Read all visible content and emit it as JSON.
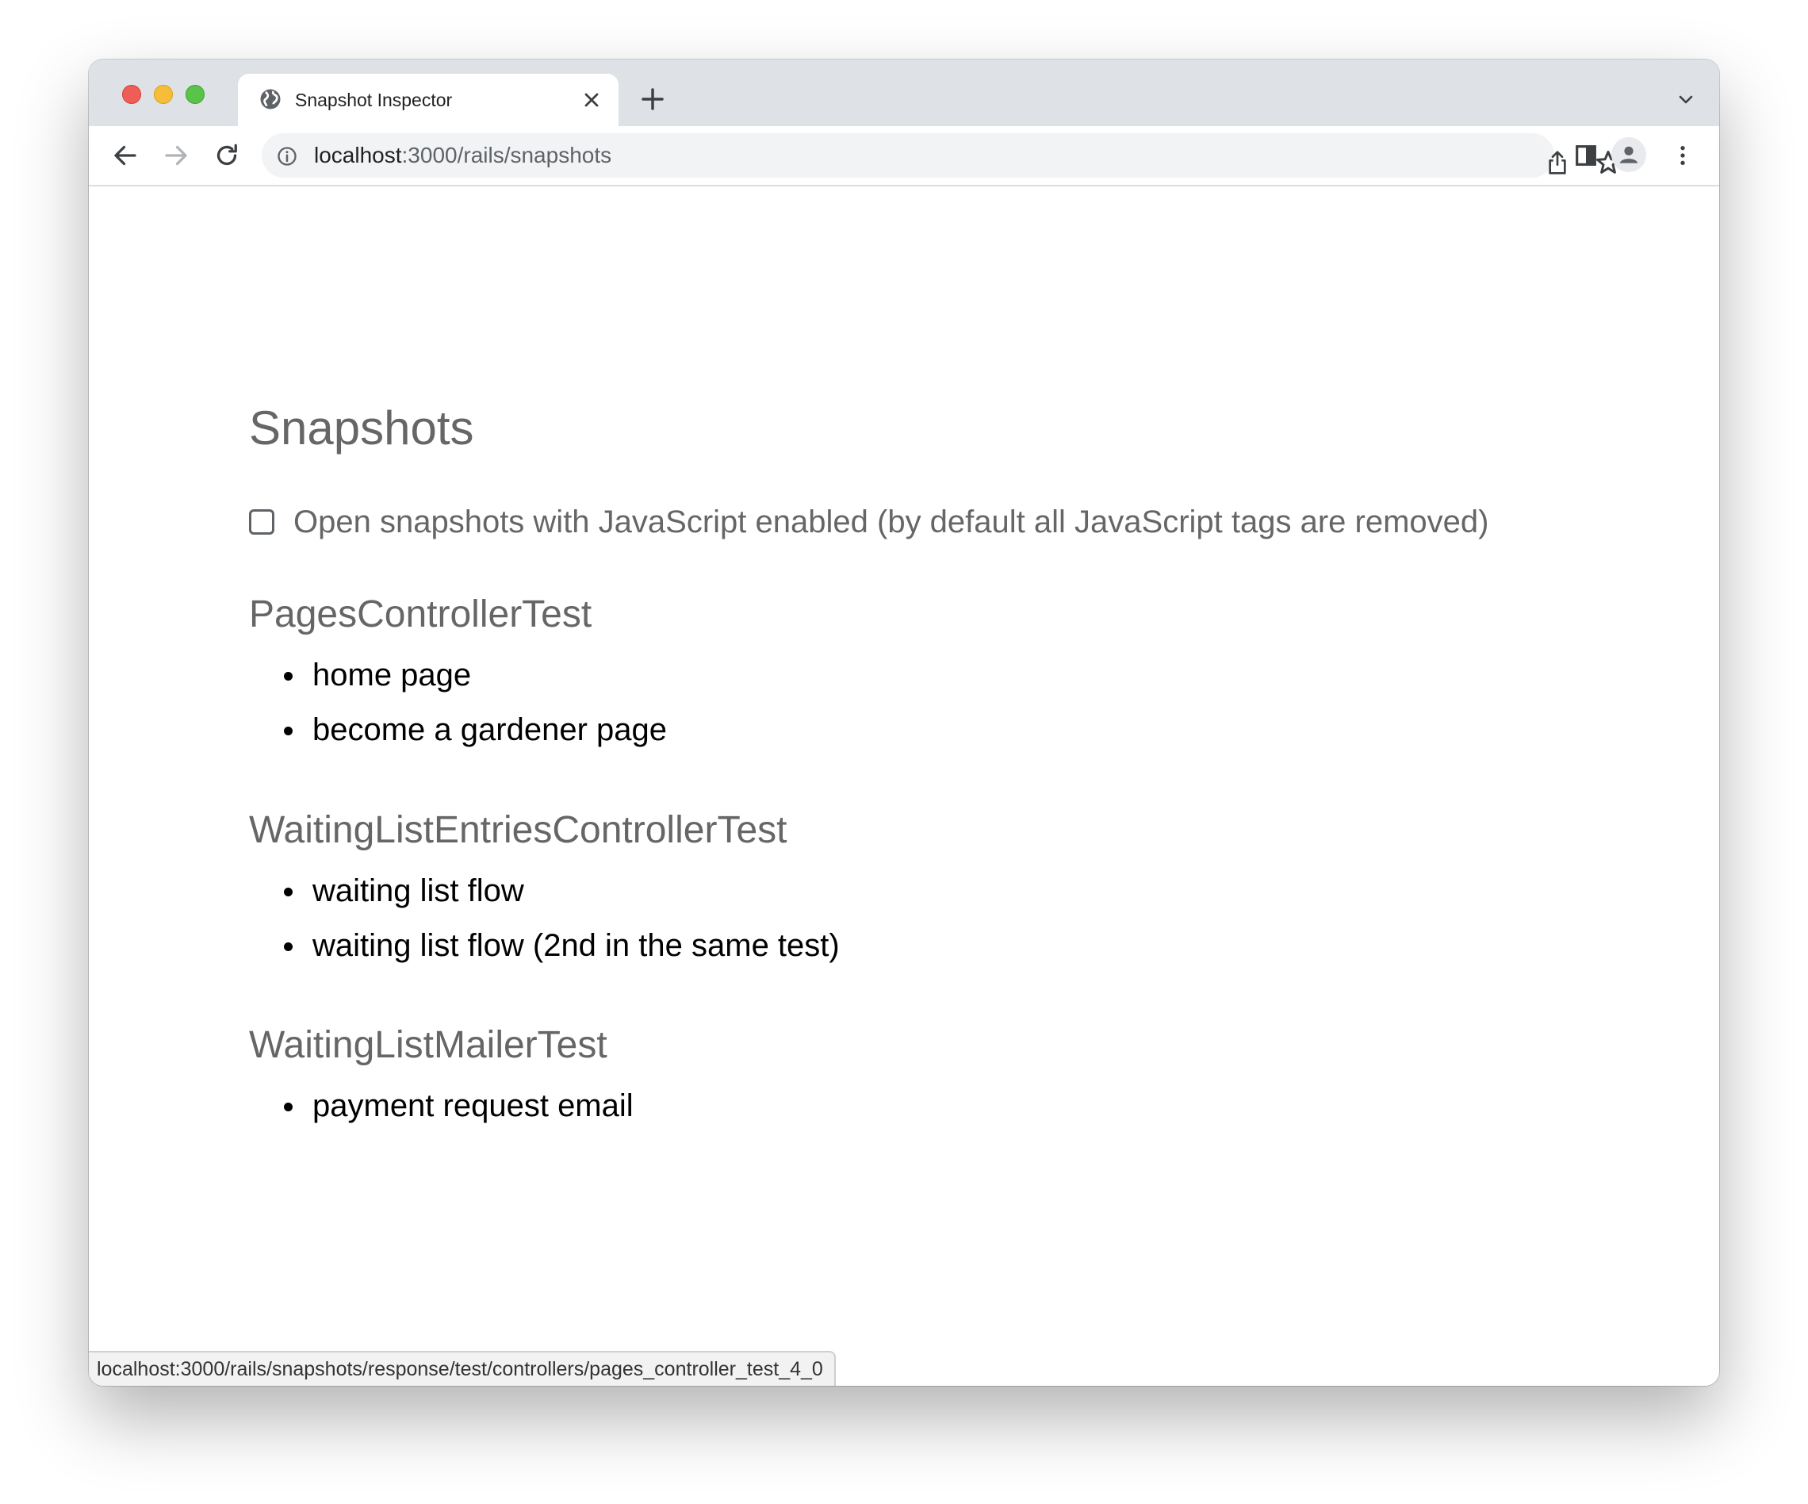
{
  "browser": {
    "tab": {
      "title": "Snapshot Inspector"
    },
    "address_bar": {
      "host": "localhost",
      "path": ":3000/rails/snapshots"
    },
    "status_url": "localhost:3000/rails/snapshots/response/test/controllers/pages_controller_test_4_0"
  },
  "page": {
    "title": "Snapshots",
    "js_option": {
      "label": "Open snapshots with JavaScript enabled (by default all JavaScript tags are removed)",
      "checked": false
    },
    "groups": [
      {
        "title": "PagesControllerTest",
        "items": [
          "home page",
          "become a gardener page"
        ]
      },
      {
        "title": "WaitingListEntriesControllerTest",
        "items": [
          "waiting list flow",
          "waiting list flow (2nd in the same test)"
        ]
      },
      {
        "title": "WaitingListMailerTest",
        "items": [
          "payment request email"
        ]
      }
    ]
  },
  "icons": {
    "tab_favicon": "globe-icon",
    "tab_close": "close-icon",
    "new_tab": "plus-icon",
    "tab_search": "chevron-down-icon",
    "back": "arrow-left-icon",
    "forward": "arrow-right-icon",
    "reload": "reload-icon",
    "site_info": "info-icon",
    "share": "share-icon",
    "bookmark": "star-icon",
    "side_panel": "side-panel-icon",
    "profile": "profile-icon",
    "menu": "kebab-menu-icon"
  },
  "colors": {
    "tabstrip": "#dee1e6",
    "heading_text": "#666666",
    "item_text": "#000000",
    "close_red": "#ee5d56",
    "minimize_yellow": "#f6bd3a",
    "zoom_green": "#5ac34a"
  }
}
